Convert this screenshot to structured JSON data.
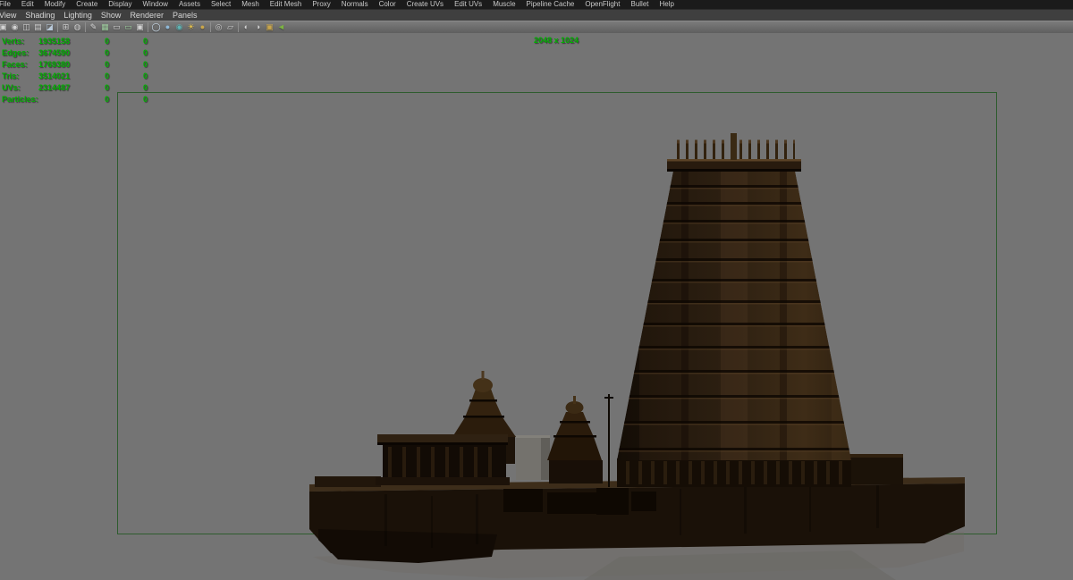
{
  "colors": {
    "viewport_bg": "#747474",
    "hud_green": "#00b000",
    "gate_green": "#2e5c2e"
  },
  "menubar": {
    "items": [
      "File",
      "Edit",
      "Modify",
      "Create",
      "Display",
      "Window",
      "Assets",
      "Select",
      "Mesh",
      "Edit Mesh",
      "Proxy",
      "Normals",
      "Color",
      "Create UVs",
      "Edit UVs",
      "Muscle",
      "Pipeline Cache",
      "OpenFlight",
      "Bullet",
      "Help"
    ]
  },
  "panel_menubar": {
    "items": [
      "View",
      "Shading",
      "Lighting",
      "Show",
      "Renderer",
      "Panels"
    ]
  },
  "toolbar": {
    "groups": [
      [
        {
          "name": "select-camera-icon",
          "glyph": "▣",
          "color": "#d2d2d2"
        },
        {
          "name": "lock-camera-icon",
          "glyph": "◉",
          "color": "#d2d2d2"
        },
        {
          "name": "camera-attributes-icon",
          "glyph": "◫",
          "color": "#d2d2d2"
        },
        {
          "name": "bookmarks-icon",
          "glyph": "▤",
          "color": "#d2d2d2"
        },
        {
          "name": "image-plane-icon",
          "glyph": "◪",
          "color": "#b9c9d9"
        }
      ],
      [
        {
          "name": "2d-pan-zoom-icon",
          "glyph": "⊞",
          "color": "#d2d2d2"
        },
        {
          "name": "oversampling-icon",
          "glyph": "◍",
          "color": "#d2d2d2"
        }
      ],
      [
        {
          "name": "grease-pencil-icon",
          "glyph": "✎",
          "color": "#dadada"
        },
        {
          "name": "grid-icon",
          "glyph": "▦",
          "color": "#9fce9f"
        },
        {
          "name": "film-gate-icon",
          "glyph": "▭",
          "color": "#d2d2d2"
        },
        {
          "name": "resolution-gate-icon",
          "glyph": "▭",
          "color": "#9fce9f"
        },
        {
          "name": "gate-mask-icon",
          "glyph": "▣",
          "color": "#d2d2d2"
        }
      ],
      [
        {
          "name": "wireframe-mode-icon",
          "glyph": "◯",
          "color": "#cfe0ef"
        },
        {
          "name": "shaded-mode-icon",
          "glyph": "●",
          "color": "#8fb8d8"
        },
        {
          "name": "textured-mode-icon",
          "glyph": "◉",
          "color": "#5fb3b3"
        },
        {
          "name": "use-all-lights-icon",
          "glyph": "☀",
          "color": "#e8c34a"
        },
        {
          "name": "shadows-icon",
          "glyph": "●",
          "color": "#c9a64b"
        }
      ],
      [
        {
          "name": "isolate-select-icon",
          "glyph": "◎",
          "color": "#d2d2d2"
        },
        {
          "name": "xray-mode-icon",
          "glyph": "▱",
          "color": "#d2d2d2"
        }
      ],
      [
        {
          "name": "exposure-icon",
          "glyph": "◐",
          "color": "#d2d2d2"
        },
        {
          "name": "gamma-icon",
          "glyph": "◑",
          "color": "#d2d2d2"
        },
        {
          "name": "snapshot-icon",
          "glyph": "▣",
          "color": "#c9a64b"
        },
        {
          "name": "plugin-shelf-icon",
          "glyph": "◄",
          "color": "#7cb342"
        }
      ]
    ]
  },
  "viewport": {
    "resolution_label": "2048 x 1024",
    "hud": {
      "rows": [
        {
          "label": "Verts:",
          "values": [
            "1935158",
            "0",
            "0"
          ]
        },
        {
          "label": "Edges:",
          "values": [
            "3674590",
            "0",
            "0"
          ]
        },
        {
          "label": "Faces:",
          "values": [
            "1769380",
            "0",
            "0"
          ]
        },
        {
          "label": "Tris:",
          "values": [
            "3514021",
            "0",
            "0"
          ]
        },
        {
          "label": "UVs:",
          "values": [
            "2314487",
            "0",
            "0"
          ]
        },
        {
          "label": "Particles:",
          "values": [
            "",
            "0",
            "0"
          ]
        }
      ]
    }
  }
}
